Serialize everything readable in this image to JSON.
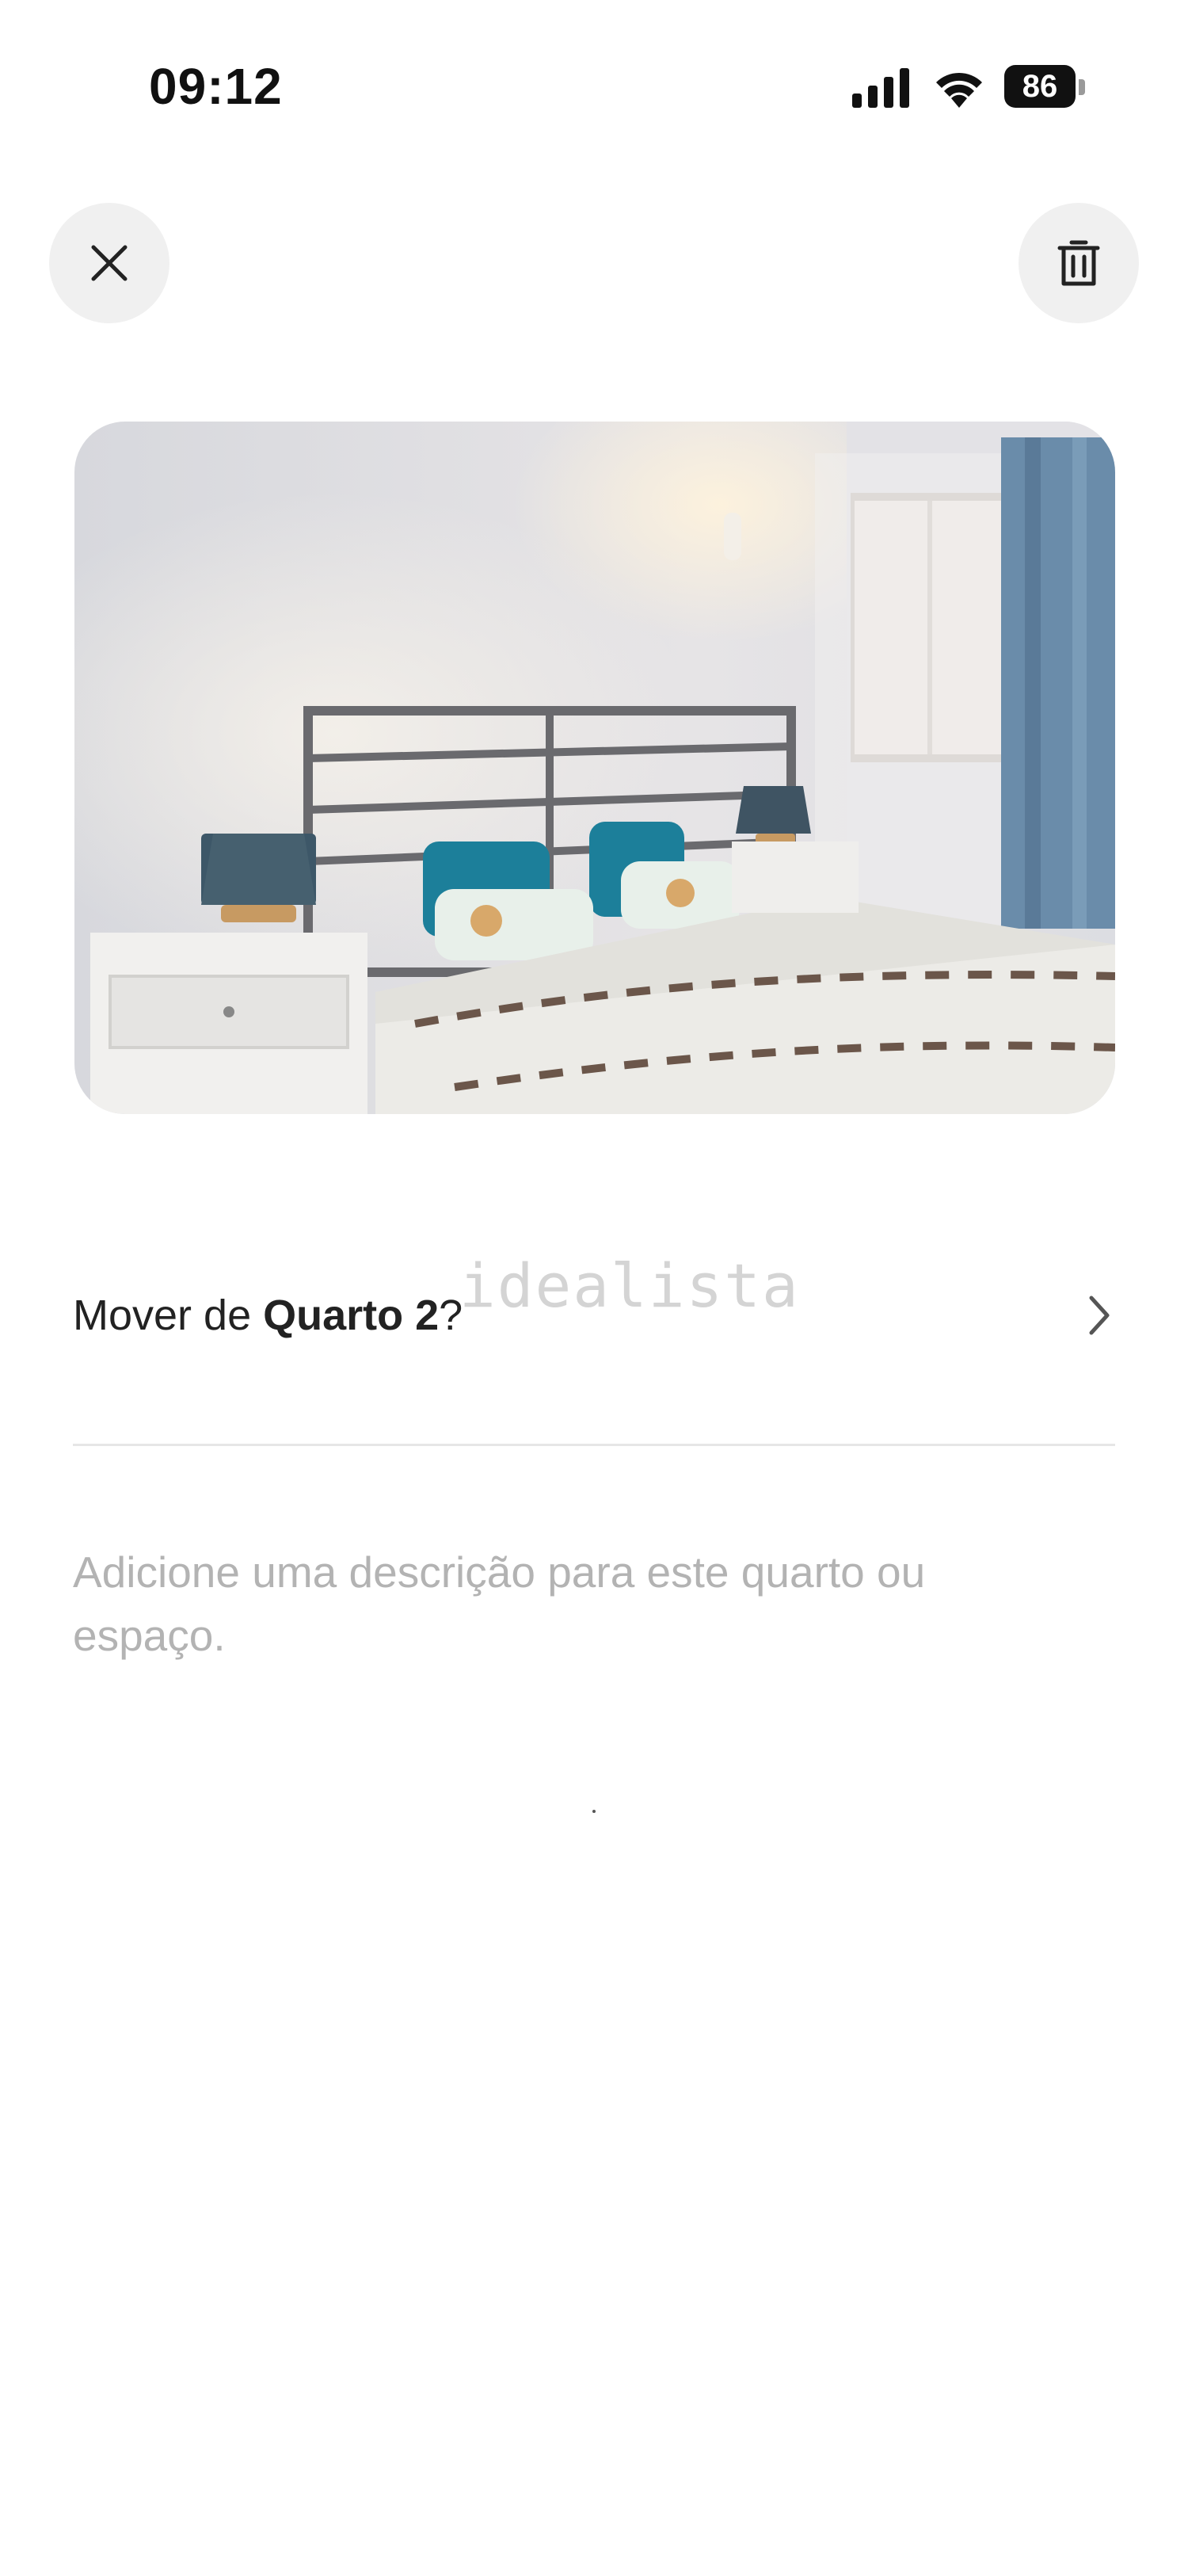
{
  "status_bar": {
    "time": "09:12",
    "battery": "86",
    "icons": [
      "signal-icon",
      "wifi-icon",
      "battery-icon"
    ]
  },
  "header": {
    "close_icon": "close-icon",
    "delete_icon": "trash-icon"
  },
  "photo": {
    "watermark": "idealista"
  },
  "move_row": {
    "prefix": "Mover de ",
    "room": "Quarto 2",
    "suffix": "?",
    "icon": "chevron-right-icon"
  },
  "description": {
    "placeholder": "Adicione uma descrição para este quarto ou espaço."
  }
}
